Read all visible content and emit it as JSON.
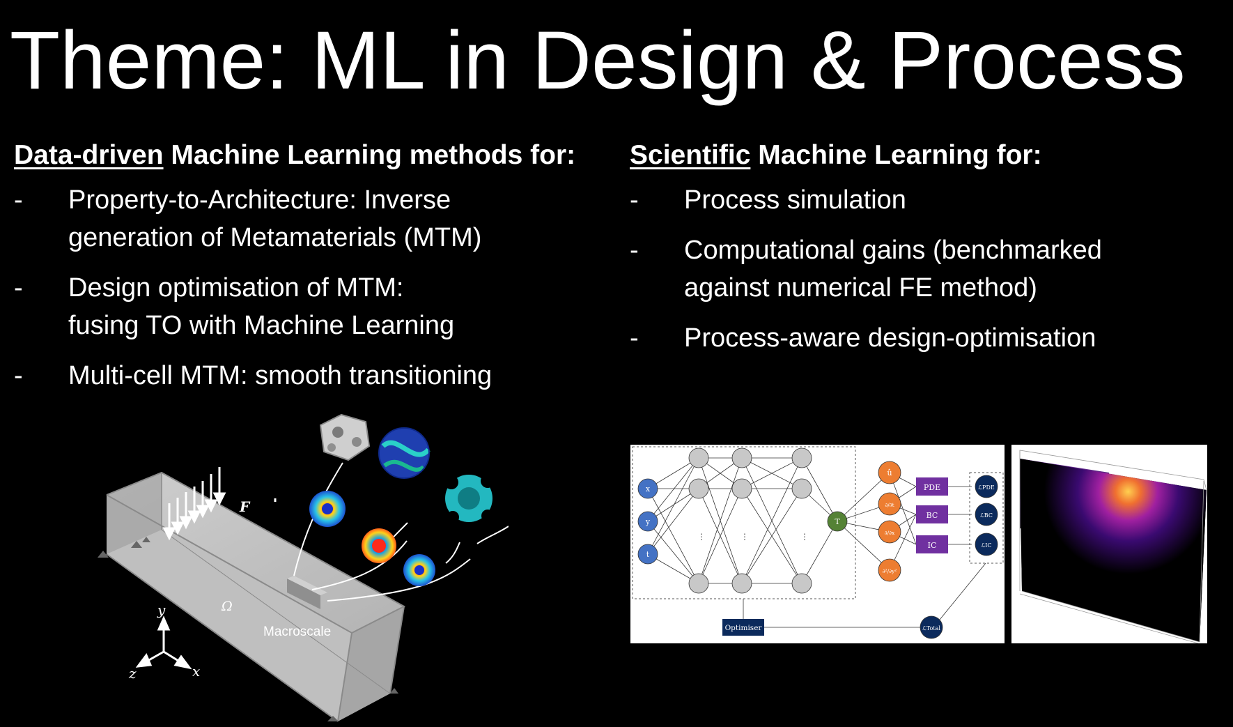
{
  "slide": {
    "title": "Theme: ML in Design & Process"
  },
  "left": {
    "heading_underlined": "Data-driven",
    "heading_rest": " Machine Learning methods for:",
    "bullets": [
      {
        "dash": "-",
        "line1": "Property-to-Architecture: Inverse",
        "line2": "generation of Metamaterials (MTM)"
      },
      {
        "dash": "-",
        "line1": "Design optimisation of MTM:",
        "line2": "fusing TO with Machine Learning"
      },
      {
        "dash": "-",
        "line1": "Multi-cell MTM: smooth transitioning",
        "line2": ""
      }
    ]
  },
  "right": {
    "heading_underlined": "Scientific",
    "heading_rest": " Machine Learning for:",
    "bullets": [
      {
        "dash": "-",
        "line1": "Process simulation",
        "line2": ""
      },
      {
        "dash": "-",
        "line1": "Computational gains (benchmarked",
        "line2": "against numerical FE method)"
      },
      {
        "dash": "-",
        "line1": "Process-aware design-optimisation",
        "line2": ""
      }
    ]
  },
  "beam_figure": {
    "force_label": "F",
    "domain_label": "Ω",
    "macro_label": "Macroscale",
    "axis_y": "y",
    "axis_z": "z",
    "axis_x": "x"
  },
  "pinn_figure": {
    "inputs": [
      "x",
      "y",
      "t"
    ],
    "output": "T",
    "derivs": [
      "û",
      "∂/∂t",
      "∂/∂x",
      "∂²/∂y²"
    ],
    "boxes": [
      "PDE",
      "BC",
      "IC"
    ],
    "losses": [
      "ℒPDE",
      "ℒBC",
      "ℒIC"
    ],
    "total_loss": "ℒTotal",
    "optimiser": "Optimiser",
    "ellipsis": "⋮",
    "colors": {
      "input": "#4472c4",
      "hidden": "#c8c8c8",
      "output": "#548235",
      "deriv": "#ed7d31",
      "box": "#7030a0",
      "loss": "#0b2a5c"
    }
  }
}
